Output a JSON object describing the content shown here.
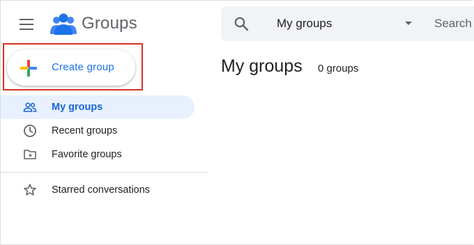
{
  "app": {
    "name": "Groups"
  },
  "search": {
    "scope": "My groups",
    "placeholder": "Search"
  },
  "create_button": {
    "label": "Create group"
  },
  "sidebar": {
    "items": [
      {
        "label": "My groups",
        "icon": "people-outline-icon",
        "active": true
      },
      {
        "label": "Recent groups",
        "icon": "clock-icon",
        "active": false
      },
      {
        "label": "Favorite groups",
        "icon": "star-folder-icon",
        "active": false
      },
      {
        "label": "Starred conversations",
        "icon": "star-outline-icon",
        "active": false
      }
    ]
  },
  "main": {
    "title": "My groups",
    "count_text": "0 groups"
  },
  "colors": {
    "accent_blue": "#1a73e8",
    "active_nav_bg": "#e8f0fe",
    "highlight_red": "#d93025",
    "search_bg": "#f1f3f4"
  }
}
